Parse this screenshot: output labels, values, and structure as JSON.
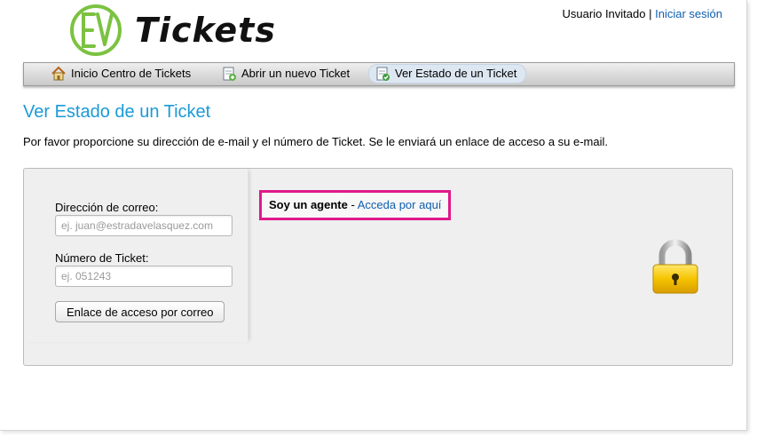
{
  "header": {
    "logo_text": "Tickets",
    "user_label": "Usuario Invitado",
    "separator": "|",
    "signin_link": "Iniciar sesión"
  },
  "nav": {
    "items": [
      {
        "label": "Inicio Centro de Tickets",
        "icon": "home-icon",
        "active": false
      },
      {
        "label": "Abrir un nuevo Ticket",
        "icon": "new-ticket-icon",
        "active": false
      },
      {
        "label": "Ver Estado de un Ticket",
        "icon": "ticket-status-icon",
        "active": true
      }
    ]
  },
  "main": {
    "title": "Ver Estado de un Ticket",
    "intro": "Por favor proporcione su dirección de e-mail y el número de Ticket. Se le enviará un enlace de acceso a su e-mail."
  },
  "form": {
    "email_label": "Dirección de correo:",
    "email_placeholder": "ej. juan@estradavelasquez.com",
    "email_value": "",
    "ticket_label": "Número de Ticket:",
    "ticket_placeholder": "ej. 051243",
    "ticket_value": "",
    "submit_label": "Enlace de acceso por correo"
  },
  "agent": {
    "prefix": "Soy un agente",
    "dash": "-",
    "link": "Acceda por aquí"
  },
  "colors": {
    "accent": "#1a9bd7",
    "link": "#0f5fb0",
    "highlight": "#e0198b",
    "logo_green": "#7cc242"
  }
}
